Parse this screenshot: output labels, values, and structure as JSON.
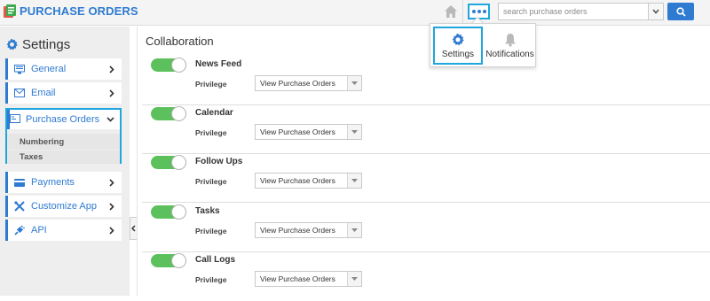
{
  "app": {
    "title": "PURCHASE ORDERS",
    "brand_color": "#2f7bd1",
    "logo_icon": "purchase-orders-logo"
  },
  "header": {
    "home_icon": "home-icon",
    "more_icon": "more-dots-icon",
    "search": {
      "placeholder": "search purchase orders",
      "value": ""
    },
    "search_button_icon": "search-icon"
  },
  "popup": {
    "items": [
      {
        "label": "Settings",
        "icon": "gear-icon",
        "selected": true
      },
      {
        "label": "Notifications",
        "icon": "bell-icon",
        "selected": false
      }
    ]
  },
  "sidebar": {
    "title": "Settings",
    "items": [
      {
        "label": "General",
        "icon": "monitor-icon"
      },
      {
        "label": "Email",
        "icon": "envelope-icon"
      },
      {
        "label": "Purchase Orders",
        "icon": "list-icon",
        "expanded": true,
        "children": [
          {
            "label": "Numbering"
          },
          {
            "label": "Taxes"
          }
        ]
      },
      {
        "label": "Payments",
        "icon": "credit-card-icon"
      },
      {
        "label": "Customize App",
        "icon": "tools-icon"
      },
      {
        "label": "API",
        "icon": "plug-icon"
      }
    ]
  },
  "main": {
    "section_title": "Collaboration",
    "privilege_label": "Privilege",
    "toggle_color": "#5cc05c",
    "rows": [
      {
        "title": "News Feed",
        "enabled": true,
        "privilege": "View Purchase Orders"
      },
      {
        "title": "Calendar",
        "enabled": true,
        "privilege": "View Purchase Orders"
      },
      {
        "title": "Follow Ups",
        "enabled": true,
        "privilege": "View Purchase Orders"
      },
      {
        "title": "Tasks",
        "enabled": true,
        "privilege": "View Purchase Orders"
      },
      {
        "title": "Call Logs",
        "enabled": true,
        "privilege": "View Purchase Orders"
      }
    ]
  }
}
